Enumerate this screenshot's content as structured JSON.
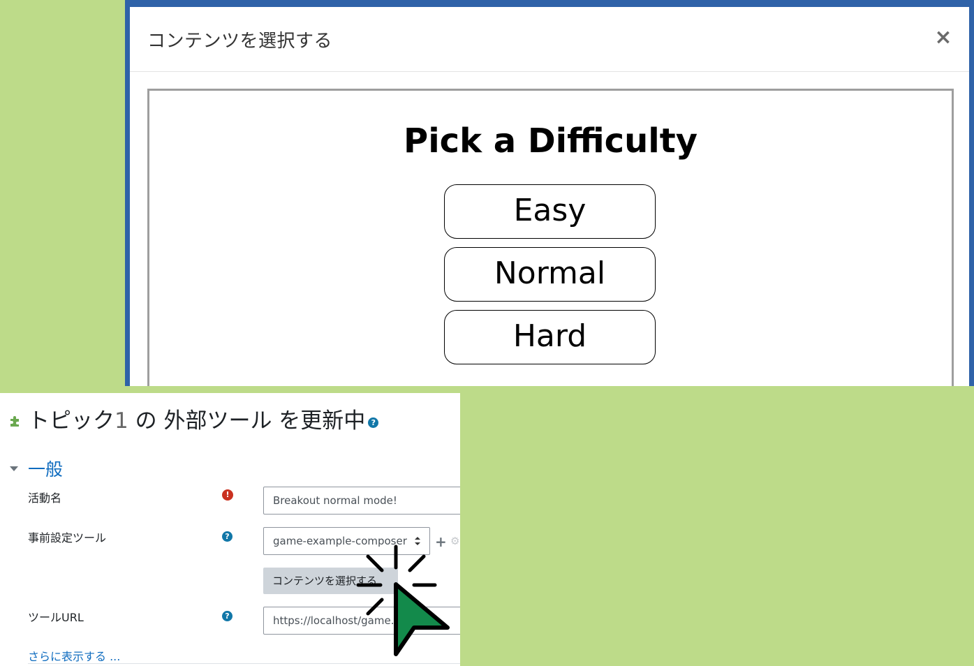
{
  "modal": {
    "title": "コンテンツを選択する",
    "close_label": "×",
    "content": {
      "heading": "Pick a Difficulty",
      "options": [
        "Easy",
        "Normal",
        "Hard"
      ]
    }
  },
  "form": {
    "heading_prefix": "トピック",
    "heading_number": "1",
    "heading_suffix": "の 外部ツール を更新中",
    "heading_icon": "puzzle-icon",
    "section_label": "一般",
    "activity_name": {
      "label": "活動名",
      "value": "Breakout normal mode!",
      "required_icon": "!"
    },
    "preconfigured_tool": {
      "label": "事前設定ツール",
      "selected": "game-example-composer",
      "add_icon": "+",
      "settings_icon": "⚙",
      "select_content_button": "コンテンツを選択する"
    },
    "tool_url": {
      "label": "ツールURL",
      "value": "https://localhost/game.php"
    },
    "help_icon": "?",
    "show_more": "さらに表示する ..."
  },
  "colors": {
    "background": "#bddb89",
    "modal_border": "#2f62a8",
    "link_blue": "#0f6cbf",
    "help_blue": "#1177a8",
    "required_red": "#ca3120",
    "cursor_green": "#138a4b"
  }
}
